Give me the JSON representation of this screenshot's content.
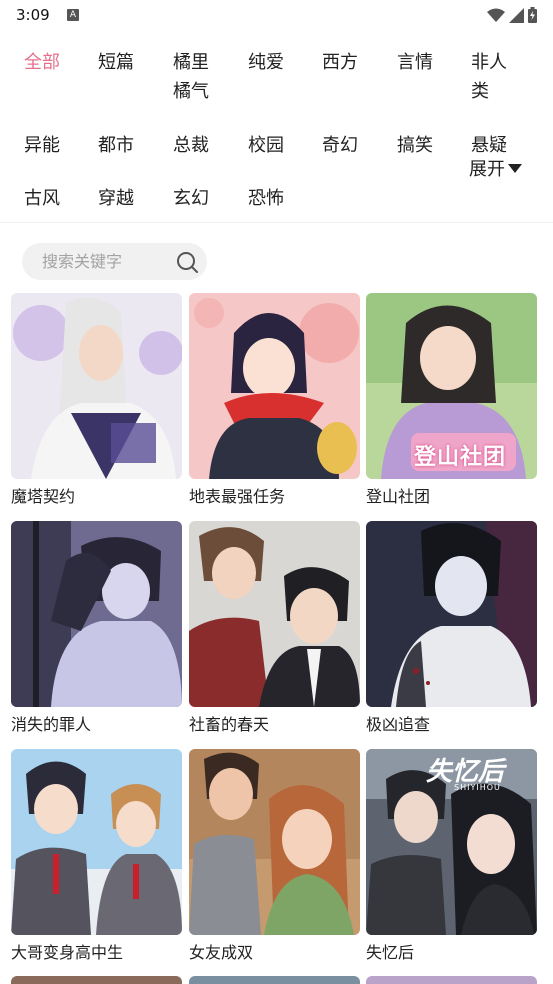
{
  "status_bar": {
    "time": "3:09",
    "notification_icon": "A"
  },
  "filters": {
    "row1": [
      {
        "label": "全部",
        "active": true
      },
      {
        "label": "短篇"
      },
      {
        "label": "橘里\n橘气"
      },
      {
        "label": "纯爱"
      },
      {
        "label": "西方"
      },
      {
        "label": "言情"
      },
      {
        "label": "非人\n类"
      }
    ],
    "row2": [
      {
        "label": "异能"
      },
      {
        "label": "都市"
      },
      {
        "label": "总裁"
      },
      {
        "label": "校园"
      },
      {
        "label": "奇幻"
      },
      {
        "label": "搞笑"
      },
      {
        "label": "悬疑"
      }
    ],
    "row3": [
      {
        "label": "古风"
      },
      {
        "label": "穿越"
      },
      {
        "label": "玄幻"
      },
      {
        "label": "恐怖"
      }
    ],
    "expand_label": "展开"
  },
  "colors": {
    "accent": "#e4708e"
  },
  "search": {
    "placeholder": "搜索关键字"
  },
  "comics": [
    {
      "title": "魔塔契约"
    },
    {
      "title": "地表最强任务"
    },
    {
      "title": "登山社团",
      "cover_text": "登山社团"
    },
    {
      "title": "消失的罪人"
    },
    {
      "title": "社畜的春天"
    },
    {
      "title": "极凶追查"
    },
    {
      "title": "大哥变身高中生"
    },
    {
      "title": "女友成双"
    },
    {
      "title": "失忆后",
      "cover_text": "失忆后",
      "cover_subtext": "SHIYIHOU"
    }
  ]
}
